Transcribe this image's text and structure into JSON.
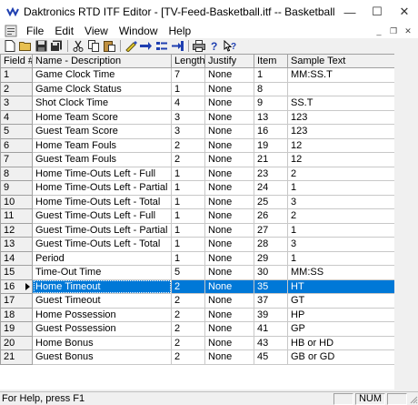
{
  "window": {
    "title": "Daktronics RTD ITF Editor - [TV-Feed-Basketball.itf -- Basketball TV Feed]"
  },
  "window_controls": {
    "minimize": "—",
    "maximize": "☐",
    "close": "✕"
  },
  "menu": [
    "File",
    "Edit",
    "View",
    "Window",
    "Help"
  ],
  "mdi_controls": {
    "minimize": "_",
    "restore": "❐",
    "close": "✕"
  },
  "toolbar": [
    "new-icon",
    "open-icon",
    "save-icon",
    "save-all-icon",
    "cut-icon",
    "copy-icon",
    "paste-icon",
    "edit-icon",
    "insert-row-icon",
    "delete-row-icon",
    "renumber-icon",
    "print-icon",
    "help-icon",
    "context-help-icon"
  ],
  "table": {
    "headers": [
      "Field #",
      "Name - Description",
      "Length",
      "Justify",
      "Item",
      "Sample Text"
    ],
    "rows": [
      [
        "1",
        "Game Clock Time",
        "7",
        "None",
        "1",
        "MM:SS.T"
      ],
      [
        "2",
        "Game Clock Status",
        "1",
        "None",
        "8",
        ""
      ],
      [
        "3",
        "Shot Clock Time",
        "4",
        "None",
        "9",
        "SS.T"
      ],
      [
        "4",
        "Home Team Score",
        "3",
        "None",
        "13",
        "123"
      ],
      [
        "5",
        "Guest Team Score",
        "3",
        "None",
        "16",
        "123"
      ],
      [
        "6",
        "Home Team Fouls",
        "2",
        "None",
        "19",
        "12"
      ],
      [
        "7",
        "Guest Team Fouls",
        "2",
        "None",
        "21",
        "12"
      ],
      [
        "8",
        "Home Time-Outs Left - Full",
        "1",
        "None",
        "23",
        "2"
      ],
      [
        "9",
        "Home Time-Outs Left - Partial",
        "1",
        "None",
        "24",
        "1"
      ],
      [
        "10",
        "Home Time-Outs Left - Total",
        "1",
        "None",
        "25",
        "3"
      ],
      [
        "11",
        "Guest Time-Outs Left - Full",
        "1",
        "None",
        "26",
        "2"
      ],
      [
        "12",
        "Guest Time-Outs Left - Partial",
        "1",
        "None",
        "27",
        "1"
      ],
      [
        "13",
        "Guest Time-Outs Left - Total",
        "1",
        "None",
        "28",
        "3"
      ],
      [
        "14",
        "Period",
        "1",
        "None",
        "29",
        "1"
      ],
      [
        "15",
        "Time-Out Time",
        "5",
        "None",
        "30",
        "MM:SS"
      ],
      [
        "16",
        "Home Timeout",
        "2",
        "None",
        "35",
        "HT"
      ],
      [
        "17",
        "Guest Timeout",
        "2",
        "None",
        "37",
        "GT"
      ],
      [
        "18",
        "Home Possession",
        "2",
        "None",
        "39",
        "HP"
      ],
      [
        "19",
        "Guest Possession",
        "2",
        "None",
        "41",
        "GP"
      ],
      [
        "20",
        "Home Bonus",
        "2",
        "None",
        "43",
        "HB or HD"
      ],
      [
        "21",
        "Guest Bonus",
        "2",
        "None",
        "45",
        "GB or GD"
      ]
    ],
    "selected_row": 15
  },
  "status": {
    "help": "For Help, press F1",
    "num": "NUM"
  },
  "colors": {
    "selection": "#0078d7",
    "accent": "#1f3fb0"
  }
}
